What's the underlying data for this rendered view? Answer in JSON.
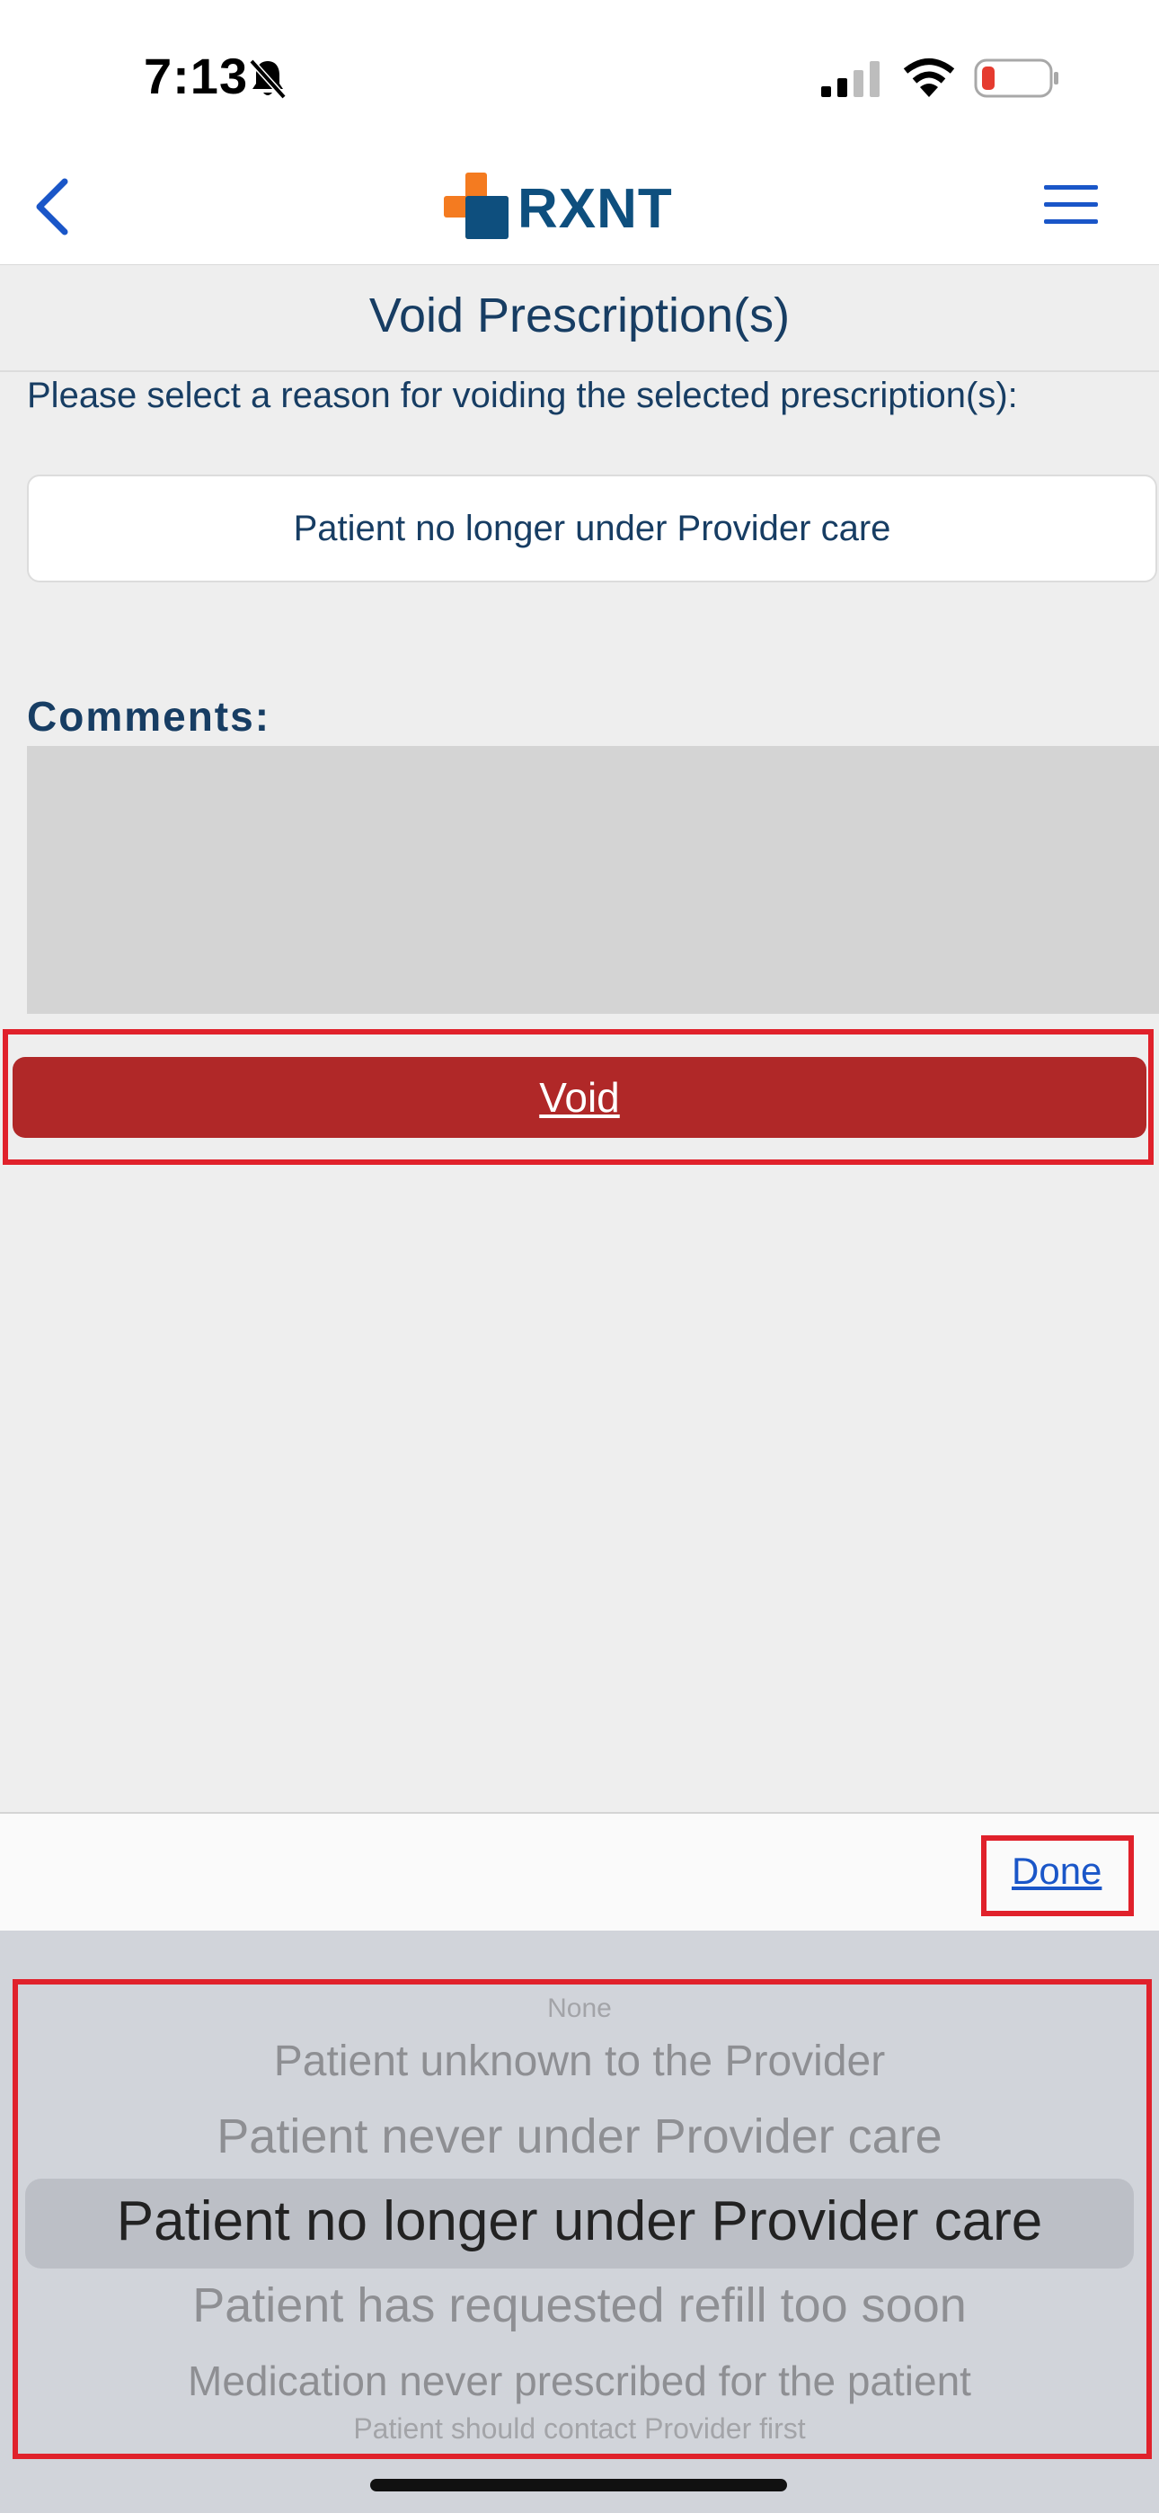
{
  "status_bar": {
    "time": "7:13",
    "icons": [
      "bell-slash-icon",
      "cellular-signal-icon",
      "wifi-icon",
      "battery-low-icon"
    ],
    "battery_color": "#e53b2f"
  },
  "nav": {
    "back_icon": "chevron-left-icon",
    "logo_text": "RXNT",
    "menu_icon": "hamburger-menu-icon",
    "colors": {
      "icon": "#1a56c8",
      "logo_text": "#0e4f7e",
      "logo_orange": "#f47b20"
    }
  },
  "page": {
    "title": "Void Prescription(s)",
    "instruction": "Please select a reason for voiding the selected prescription(s):",
    "selected_reason": "Patient no longer under Provider care",
    "comments_label": "Comments:",
    "comments_value": "",
    "void_label": "Void",
    "void_color": "#b02828"
  },
  "picker": {
    "done_label": "Done",
    "options": [
      "None",
      "Patient unknown to the Provider",
      "Patient never under Provider care",
      "Patient no longer under Provider care",
      "Patient has requested refill too soon",
      "Medication never prescribed for the patient",
      "Patient should contact Provider first"
    ],
    "selected_index": 3
  }
}
